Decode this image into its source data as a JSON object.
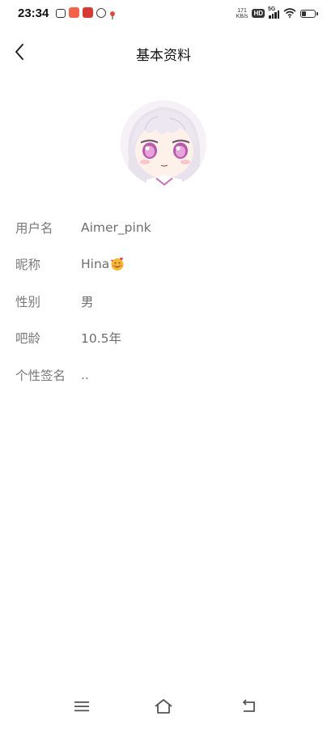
{
  "status_bar": {
    "time": "23:34",
    "net_speed_value": "171",
    "net_speed_unit": "KB/s",
    "hd_badge": "HD",
    "signal_label": "5G",
    "icons": [
      "tv-icon",
      "app-icon",
      "app-icon",
      "clock-app-icon",
      "location-icon",
      "wifi-icon",
      "battery-icon"
    ]
  },
  "header": {
    "title": "基本资料",
    "back_icon": "chevron-left-icon"
  },
  "profile": {
    "avatar": "anime-girl-avatar",
    "fields": [
      {
        "label": "用户名",
        "value": "Aimer_pink"
      },
      {
        "label": "昵称",
        "value": "Hina",
        "emoji": "smiling-face-with-hearts"
      },
      {
        "label": "性别",
        "value": "男"
      },
      {
        "label": "吧龄",
        "value": "10.5年"
      },
      {
        "label": "个性签名",
        "value": ".."
      }
    ]
  },
  "nav_bar": {
    "icons": [
      "menu-icon",
      "home-icon",
      "back-icon"
    ]
  },
  "colors": {
    "background": "#ffffff",
    "label": "#7a7a7a",
    "value": "#6e6e6e",
    "title": "#111111"
  }
}
